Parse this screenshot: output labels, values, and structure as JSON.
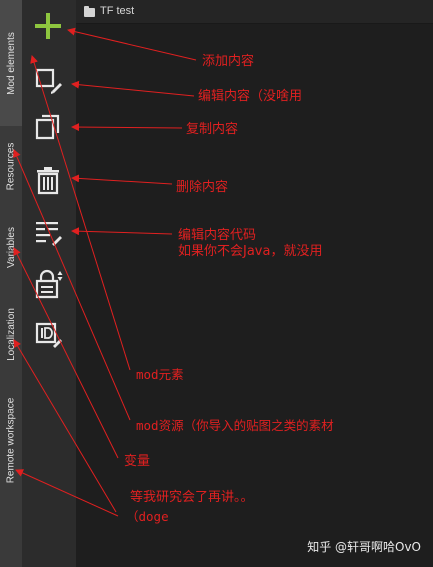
{
  "window": {
    "title": "TF test"
  },
  "side_tabs": [
    {
      "id": "mod-elements",
      "label": "Mod elements"
    },
    {
      "id": "resources",
      "label": "Resources"
    },
    {
      "id": "variables",
      "label": "Variables"
    },
    {
      "id": "localization",
      "label": "Localization"
    },
    {
      "id": "remote-workspace",
      "label": "Remote workspace"
    }
  ],
  "toolbar": [
    {
      "id": "add",
      "icon": "plus-icon"
    },
    {
      "id": "edit",
      "icon": "edit-box-icon"
    },
    {
      "id": "duplicate",
      "icon": "duplicate-icon"
    },
    {
      "id": "delete",
      "icon": "trash-icon"
    },
    {
      "id": "edit-code",
      "icon": "code-edit-icon"
    },
    {
      "id": "lock",
      "icon": "lock-icon"
    },
    {
      "id": "id-edit",
      "icon": "id-edit-icon"
    }
  ],
  "annotations": {
    "add": "添加内容",
    "edit": "编辑内容（没啥用",
    "duplicate": "复制内容",
    "delete": "删除内容",
    "code_line1": "编辑内容代码",
    "code_line2": "如果你不会Java，就没用",
    "mod_elements": "mod元素",
    "resources": "mod资源（你导入的贴图之类的素材",
    "variables": "变量",
    "remote_line1": "等我研究会了再讲。。",
    "remote_line2": "（doge"
  },
  "watermark": "知乎 @轩哥啊哈OvO",
  "colors": {
    "annotation": "#e02020",
    "plus": "#8ec63f",
    "sidebar": "#3a3a3a",
    "toolbar": "#2c2c2c"
  }
}
